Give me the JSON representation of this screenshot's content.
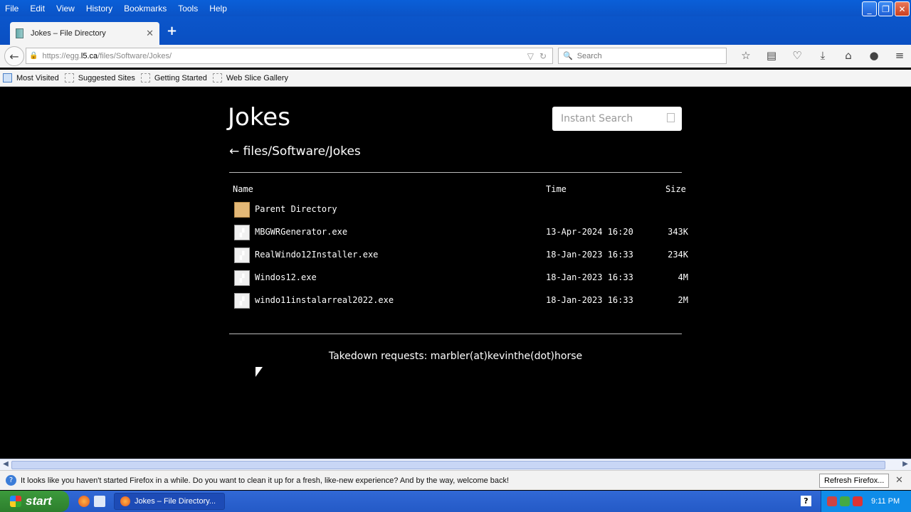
{
  "menu": [
    "File",
    "Edit",
    "View",
    "History",
    "Bookmarks",
    "Tools",
    "Help"
  ],
  "window_controls": {
    "minimize": "_",
    "restore": "❐",
    "close": "✕"
  },
  "tab": {
    "title": "Jokes – File Directory",
    "close": "✕",
    "new_tab": "+"
  },
  "nav": {
    "back_icon": "←",
    "url_prefix": "https://egg.",
    "url_domain": "l5.ca",
    "url_path": "/files/Software/Jokes/",
    "search_placeholder": "Search"
  },
  "bookmarks": [
    "Most Visited",
    "Suggested Sites",
    "Getting Started",
    "Web Slice Gallery"
  ],
  "page": {
    "title": "Jokes",
    "instant_search_placeholder": "Instant Search",
    "breadcrumb": "← files/Software/Jokes",
    "headers": {
      "name": "Name",
      "time": "Time",
      "size": "Size"
    },
    "rows": [
      {
        "name": "Parent Directory",
        "time": "",
        "size": "",
        "icon": "folder-icon"
      },
      {
        "name": "MBGWRGenerator.exe",
        "time": "13-Apr-2024 16:20",
        "size": "343K",
        "icon": "exe-icon"
      },
      {
        "name": "RealWindo12Installer.exe",
        "time": "18-Jan-2023 16:33",
        "size": "234K",
        "icon": "exe-icon"
      },
      {
        "name": "Windos12.exe",
        "time": "18-Jan-2023 16:33",
        "size": "4M",
        "icon": "exe-icon"
      },
      {
        "name": "windo11instalarreal2022.exe",
        "time": "18-Jan-2023 16:33",
        "size": "2M",
        "icon": "exe-icon"
      }
    ],
    "footer": "Takedown requests: marbler(at)kevinthe(dot)horse"
  },
  "notification": {
    "text": "It looks like you haven't started Firefox in a while. Do you want to clean it up for a fresh, like-new experience? And by the way, welcome back!",
    "button": "Refresh Firefox...",
    "close": "✕"
  },
  "taskbar": {
    "start": "start",
    "item": "Jokes – File Directory...",
    "clock": "9:11 PM",
    "help": "?"
  }
}
